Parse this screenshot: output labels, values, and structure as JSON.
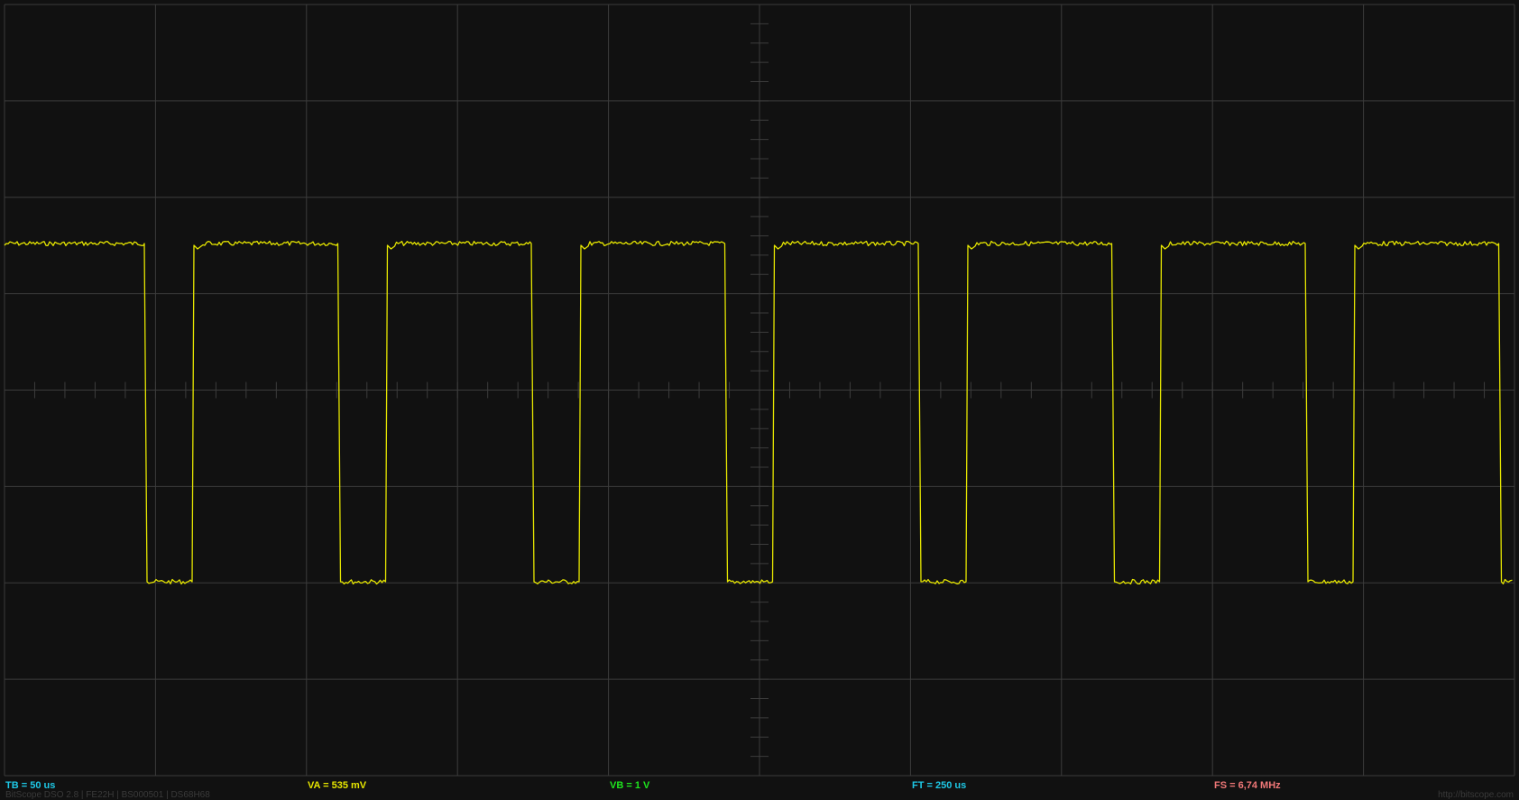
{
  "readouts": {
    "timebase": {
      "label": "TB = 50 us",
      "color": "#1ec8e6"
    },
    "channel_a": {
      "label": "VA = 535 mV",
      "color": "#e6e600"
    },
    "channel_b": {
      "label": "VB = 1 V",
      "color": "#1ee61e"
    },
    "frame_time": {
      "label": "FT = 250 us",
      "color": "#1ec8e6"
    },
    "sample_rate": {
      "label": "FS = 6,74 MHz",
      "color": "#f07878"
    }
  },
  "footer": {
    "app_info": "BitScope DSO 2.8 | FE22H | BS000501 | DS68H68",
    "website": "http://bitscope.com"
  },
  "colors": {
    "background": "#111111",
    "grid": "#3c3c3c",
    "trace": "#e6e600"
  }
}
